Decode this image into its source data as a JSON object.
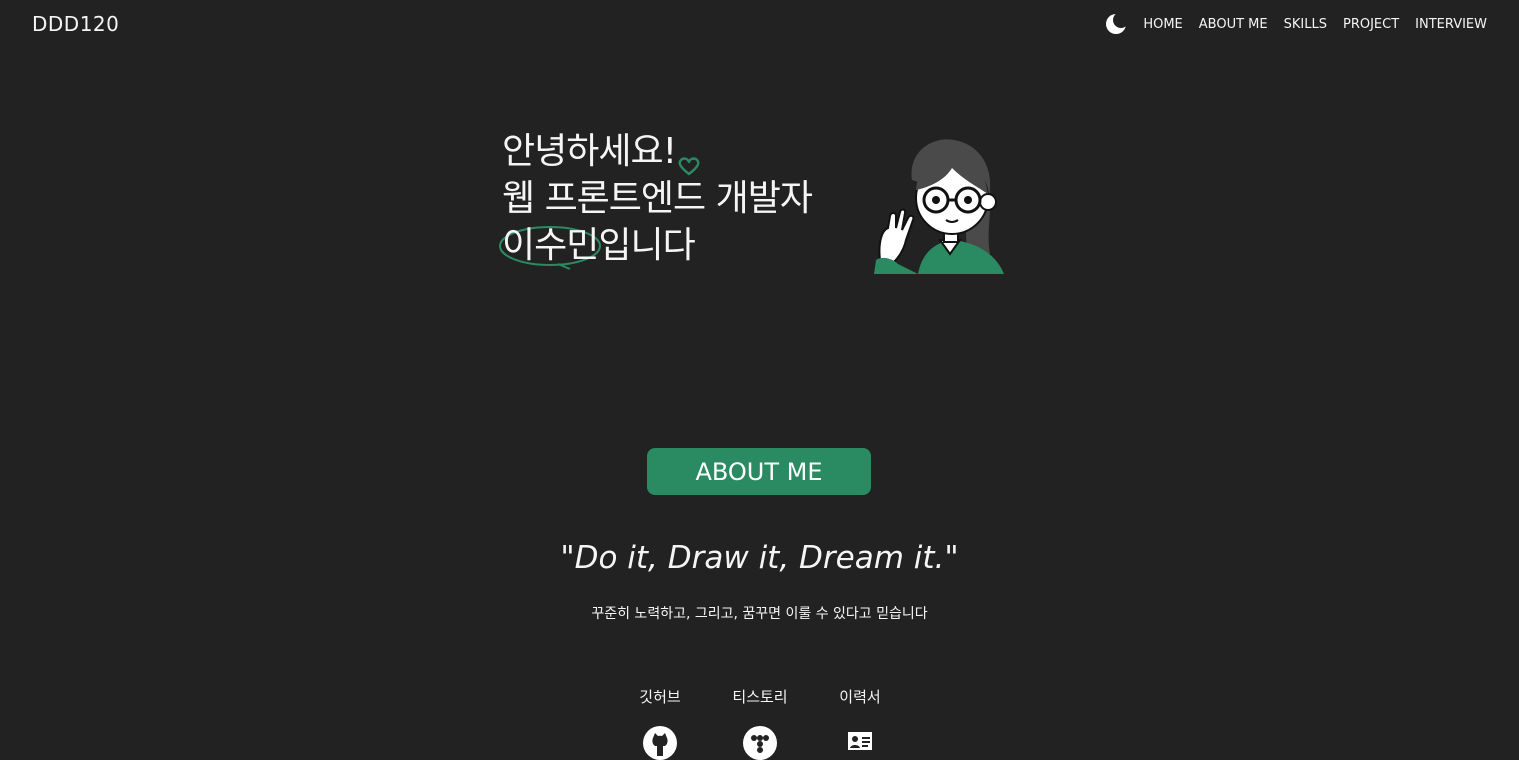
{
  "header": {
    "logo": "DDD120",
    "theme_icon": "moon-icon",
    "nav": [
      "HOME",
      "ABOUT ME",
      "SKILLS",
      "PROJECT",
      "INTERVIEW"
    ]
  },
  "hero": {
    "line1": "안녕하세요!",
    "line2": "웹 프론트엔드 개발자",
    "name": "이수민",
    "line3_suffix": "입니다",
    "heart_icon": "heart-outline-icon",
    "avatar": "waving-developer-avatar"
  },
  "about_button": "ABOUT ME",
  "quote": "\"Do it, Draw it, Dream it.\"",
  "subtitle": "꾸준히 노력하고, 그리고, 꿈꾸면 이룰 수 있다고 믿습니다",
  "links": [
    {
      "label": "깃허브",
      "icon": "github-icon"
    },
    {
      "label": "티스토리",
      "icon": "tistory-icon"
    },
    {
      "label": "이력서",
      "icon": "resume-card-icon"
    }
  ],
  "colors": {
    "background": "#222222",
    "accent": "#2a8a62",
    "text": "#f5f5f5"
  }
}
